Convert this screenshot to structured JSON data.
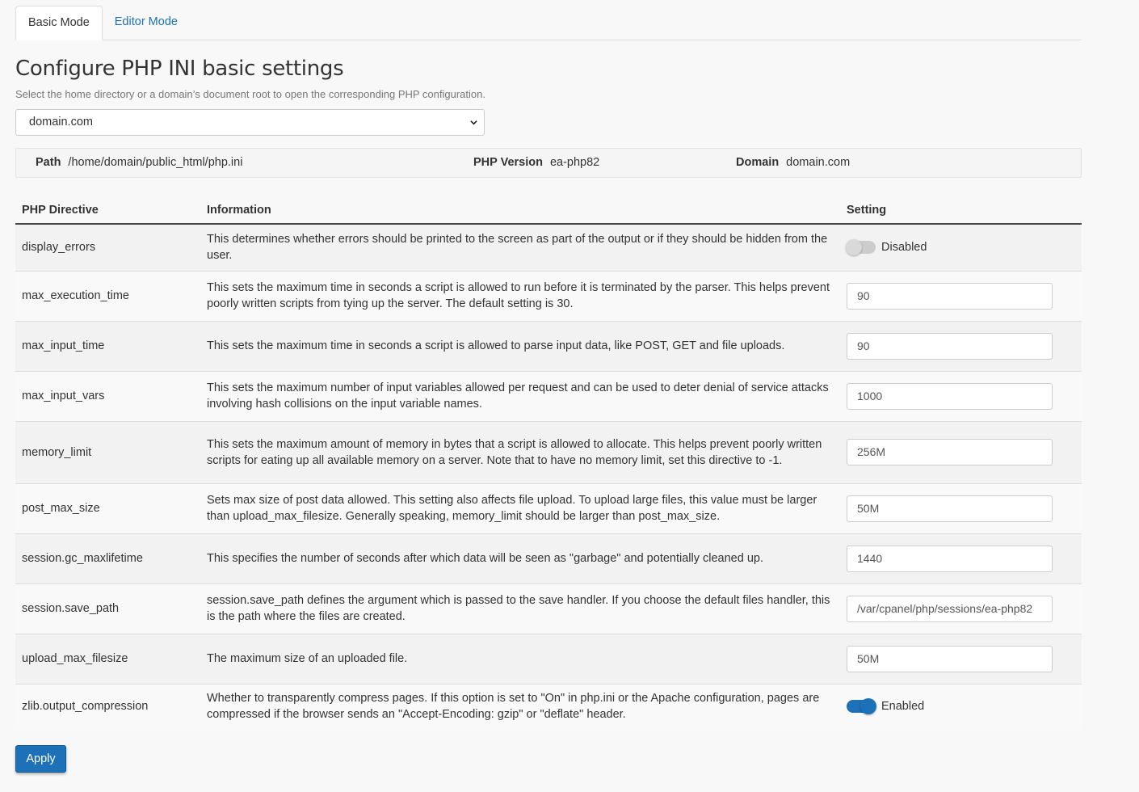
{
  "tabs": [
    {
      "label": "Basic Mode",
      "active": true
    },
    {
      "label": "Editor Mode",
      "active": false
    }
  ],
  "heading": "Configure PHP INI basic settings",
  "subtitle": "Select the home directory or a domain’s document root to open the corresponding PHP configuration.",
  "domain_select": {
    "value": "domain.com"
  },
  "info": {
    "path_label": "Path",
    "path_value": "/home/domain/public_html/php.ini",
    "version_label": "PHP Version",
    "version_value": "ea-php82",
    "domain_label": "Domain",
    "domain_value": "domain.com"
  },
  "table": {
    "headers": [
      "PHP Directive",
      "Information",
      "Setting"
    ],
    "rows": [
      {
        "directive": "display_errors",
        "info": "This determines whether errors should be printed to the screen as part of the output or if they should be hidden from the user.",
        "type": "toggle",
        "enabled": false,
        "state_label": "Disabled"
      },
      {
        "directive": "max_execution_time",
        "info": "This sets the maximum time in seconds a script is allowed to run before it is terminated by the parser. This helps prevent poorly written scripts from tying up the server. The default setting is 30.",
        "type": "text",
        "value": "90"
      },
      {
        "directive": "max_input_time",
        "info": "This sets the maximum time in seconds a script is allowed to parse input data, like POST, GET and file uploads.",
        "type": "text",
        "value": "90"
      },
      {
        "directive": "max_input_vars",
        "info": "This sets the maximum number of input variables allowed per request and can be used to deter denial of service attacks involving hash collisions on the input variable names.",
        "type": "text",
        "value": "1000"
      },
      {
        "directive": "memory_limit",
        "info": "This sets the maximum amount of memory in bytes that a script is allowed to allocate. This helps prevent poorly written scripts for eating up all available memory on a server. Note that to have no memory limit, set this directive to -1.",
        "type": "text",
        "value": "256M"
      },
      {
        "directive": "post_max_size",
        "info": "Sets max size of post data allowed. This setting also affects file upload. To upload large files, this value must be larger than upload_max_filesize. Generally speaking, memory_limit should be larger than post_max_size.",
        "type": "text",
        "value": "50M"
      },
      {
        "directive": "session.gc_maxlifetime",
        "info": "This specifies the number of seconds after which data will be seen as \"garbage\" and potentially cleaned up.",
        "type": "text",
        "value": "1440"
      },
      {
        "directive": "session.save_path",
        "info": "session.save_path defines the argument which is passed to the save handler. If you choose the default files handler, this is the path where the files are created.",
        "type": "text",
        "value": "/var/cpanel/php/sessions/ea-php82"
      },
      {
        "directive": "upload_max_filesize",
        "info": "The maximum size of an uploaded file.",
        "type": "text",
        "value": "50M"
      },
      {
        "directive": "zlib.output_compression",
        "info": "Whether to transparently compress pages. If this option is set to \"On\" in php.ini or the Apache configuration, pages are compressed if the browser sends an \"Accept-Encoding: gzip\" or \"deflate\" header.",
        "type": "toggle",
        "enabled": true,
        "state_label": "Enabled"
      }
    ]
  },
  "apply_label": "Apply",
  "colors": {
    "accent": "#1d71b8",
    "text": "#333333"
  }
}
